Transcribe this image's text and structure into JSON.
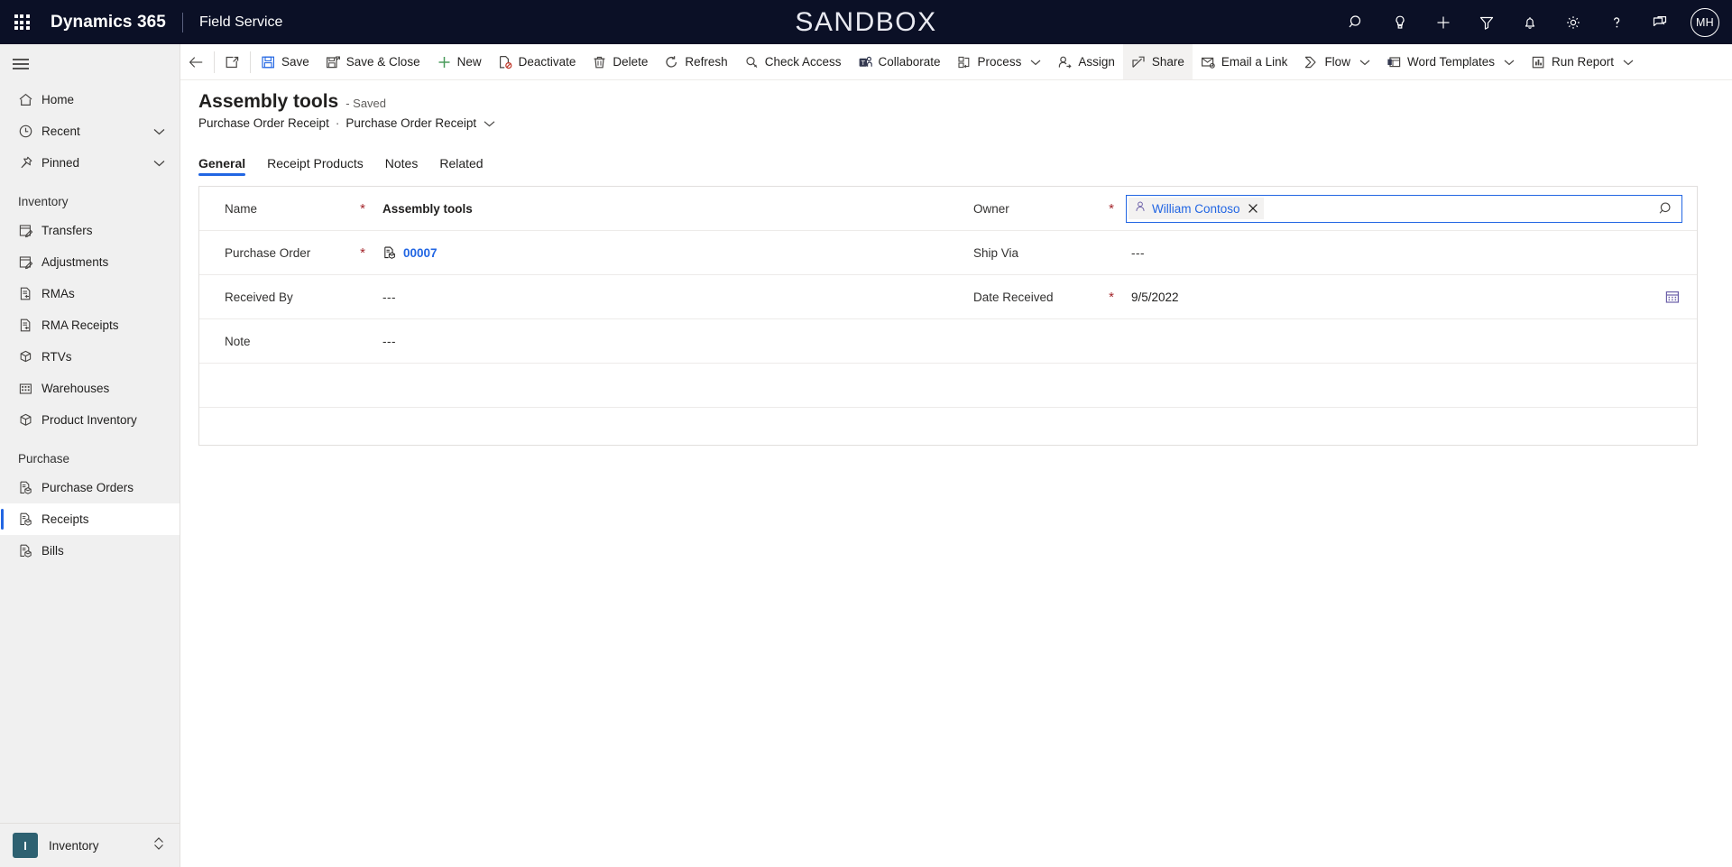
{
  "topbar": {
    "waffle": "app-launcher",
    "brand": "Dynamics 365",
    "app_name": "Field Service",
    "environment_label": "SANDBOX",
    "icons": [
      {
        "name": "search-icon",
        "label": "Search"
      },
      {
        "name": "lightbulb-icon",
        "label": "Ideas"
      },
      {
        "name": "quick-create-icon",
        "label": "New"
      },
      {
        "name": "filter-icon",
        "label": "Filter"
      },
      {
        "name": "notifications-bell-icon",
        "label": "Notifications"
      },
      {
        "name": "settings-gear-icon",
        "label": "Settings"
      },
      {
        "name": "help-question-icon",
        "label": "Help"
      },
      {
        "name": "feedback-chat-icon",
        "label": "Feedback"
      }
    ],
    "avatar_initials": "MH"
  },
  "sidebar": {
    "hamburger": "menu-icon",
    "top_items": [
      {
        "label": "Home",
        "icon": "home-icon",
        "chevron": false
      },
      {
        "label": "Recent",
        "icon": "clock-icon",
        "chevron": true
      },
      {
        "label": "Pinned",
        "icon": "pin-icon",
        "chevron": true
      }
    ],
    "groups": [
      {
        "title": "Inventory",
        "items": [
          {
            "label": "Transfers",
            "icon": "transfers-icon",
            "selected": false
          },
          {
            "label": "Adjustments",
            "icon": "adjustments-icon",
            "selected": false
          },
          {
            "label": "RMAs",
            "icon": "document-return-icon",
            "selected": false
          },
          {
            "label": "RMA Receipts",
            "icon": "document-return-icon",
            "selected": false
          },
          {
            "label": "RTVs",
            "icon": "box-return-icon",
            "selected": false
          },
          {
            "label": "Warehouses",
            "icon": "building-icon",
            "selected": false
          },
          {
            "label": "Product Inventory",
            "icon": "box-icon",
            "selected": false
          }
        ]
      },
      {
        "title": "Purchase",
        "items": [
          {
            "label": "Purchase Orders",
            "icon": "document-box-icon",
            "selected": false
          },
          {
            "label": "Receipts",
            "icon": "document-box-icon",
            "selected": true
          },
          {
            "label": "Bills",
            "icon": "document-box-icon",
            "selected": false
          }
        ]
      }
    ],
    "area_switcher": {
      "badge": "I",
      "label": "Inventory"
    }
  },
  "commandbar": {
    "back": "back-arrow-icon",
    "popout": "open-in-new-window-icon",
    "buttons": [
      {
        "label": "Save",
        "icon": "save-floppy-icon",
        "chevron": false,
        "active": false
      },
      {
        "label": "Save & Close",
        "icon": "save-and-close-icon",
        "chevron": false,
        "active": false
      },
      {
        "label": "New",
        "icon": "plus-icon",
        "chevron": false,
        "active": false
      },
      {
        "label": "Deactivate",
        "icon": "deactivate-icon",
        "chevron": false,
        "active": false
      },
      {
        "label": "Delete",
        "icon": "trash-icon",
        "chevron": false,
        "active": false
      },
      {
        "label": "Refresh",
        "icon": "refresh-icon",
        "chevron": false,
        "active": false
      },
      {
        "label": "Check Access",
        "icon": "check-access-key-icon",
        "chevron": false,
        "active": false
      },
      {
        "label": "Collaborate",
        "icon": "teams-collaborate-icon",
        "chevron": false,
        "active": false
      },
      {
        "label": "Process",
        "icon": "process-icon",
        "chevron": true,
        "active": false
      },
      {
        "label": "Assign",
        "icon": "assign-person-icon",
        "chevron": false,
        "active": false
      },
      {
        "label": "Share",
        "icon": "share-icon",
        "chevron": false,
        "active": true
      },
      {
        "label": "Email a Link",
        "icon": "email-link-icon",
        "chevron": false,
        "active": false
      },
      {
        "label": "Flow",
        "icon": "flow-icon",
        "chevron": true,
        "active": false
      },
      {
        "label": "Word Templates",
        "icon": "word-template-icon",
        "chevron": true,
        "active": false
      },
      {
        "label": "Run Report",
        "icon": "run-report-icon",
        "chevron": true,
        "active": false
      }
    ],
    "overflow": "overflow-chevron-icon"
  },
  "form": {
    "title": "Assembly tools",
    "state": "- Saved",
    "breadcrumb": {
      "parent": "Purchase Order Receipt",
      "separator": "·",
      "current": "Purchase Order Receipt",
      "chevron": "chevron-down-icon"
    },
    "tabs": [
      {
        "label": "General",
        "active": true
      },
      {
        "label": "Receipt Products",
        "active": false
      },
      {
        "label": "Notes",
        "active": false
      },
      {
        "label": "Related",
        "active": false
      }
    ],
    "left_fields": [
      {
        "label": "Name",
        "required": true,
        "value": "Assembly tools",
        "type": "text-bold"
      },
      {
        "label": "Purchase Order",
        "required": true,
        "value": "00007",
        "type": "lookup-link",
        "icon": "document-box-icon"
      },
      {
        "label": "Received By",
        "required": false,
        "value": "---",
        "type": "text"
      },
      {
        "label": "Note",
        "required": false,
        "value": "---",
        "type": "text"
      }
    ],
    "right_fields": [
      {
        "label": "Owner",
        "required": true,
        "value": "William Contoso",
        "type": "lookup-active",
        "icon": "person-icon",
        "clear": "close-icon",
        "search": "search-icon"
      },
      {
        "label": "Ship Via",
        "required": false,
        "value": "---",
        "type": "text"
      },
      {
        "label": "Date Received",
        "required": true,
        "value": "9/5/2022",
        "type": "date",
        "icon": "calendar-icon"
      }
    ]
  },
  "colors": {
    "nav_background": "#0b1026",
    "accent_blue": "#2266e3",
    "required_red": "#a4262c",
    "sidebar_background": "#f0f0f0",
    "area_badge": "#2e6171"
  }
}
